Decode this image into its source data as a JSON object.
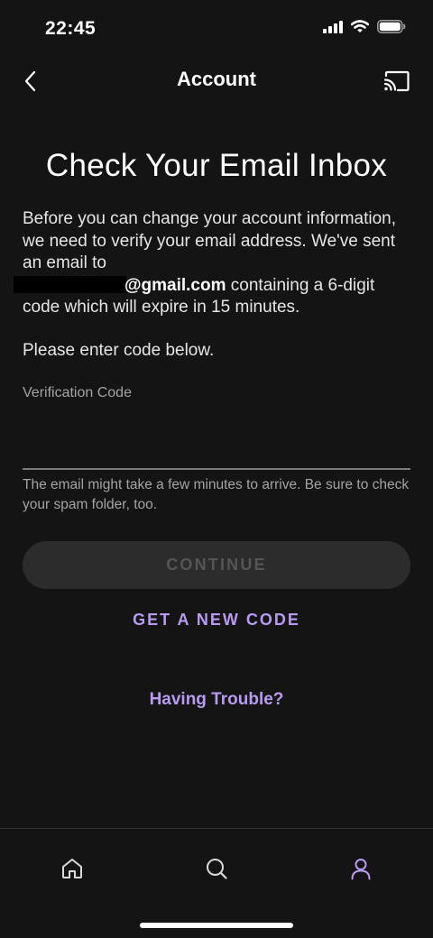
{
  "status_bar": {
    "time": "22:45"
  },
  "nav": {
    "title": "Account"
  },
  "main": {
    "title": "Check Your Email Inbox",
    "body_part1": "Before you can change your account information, we need to verify your email address. We've sent an email to",
    "email_domain": "@gmail.com",
    "body_part2": "containing a 6-digit code which will expire in 15 minutes.",
    "instruction": "Please enter code below.",
    "field_label": "Verification Code",
    "field_value": "",
    "hint": "The email might take a few minutes to arrive. Be sure to check your spam folder, too.",
    "continue_label": "CONTINUE",
    "new_code_label": "GET A NEW CODE",
    "trouble_label": "Having Trouble?"
  },
  "tabs": [
    {
      "icon": "home-icon",
      "active": false
    },
    {
      "icon": "search-icon",
      "active": false
    },
    {
      "icon": "profile-icon",
      "active": true
    }
  ],
  "colors": {
    "background": "#141414",
    "accent": "#b89bf0",
    "button_disabled_bg": "#2c2c2c",
    "button_disabled_text": "#555555"
  }
}
